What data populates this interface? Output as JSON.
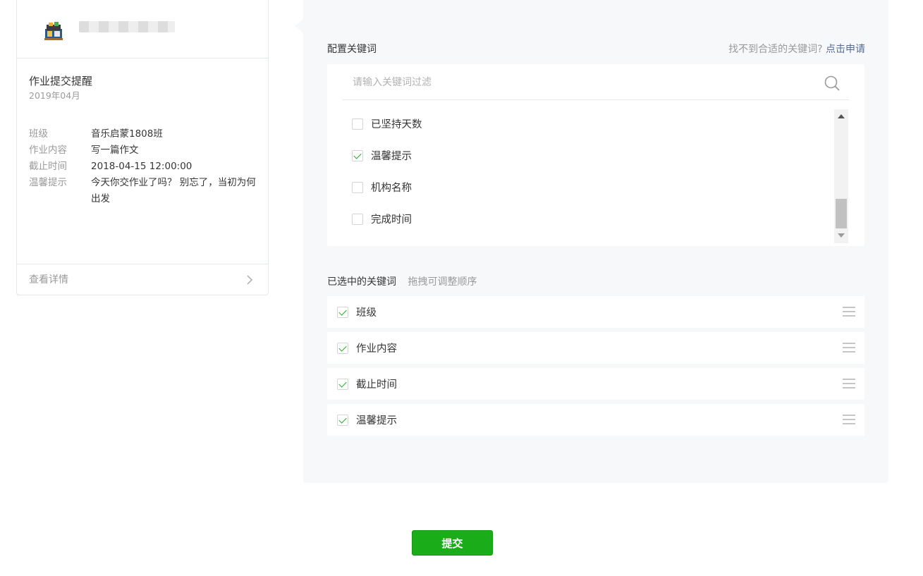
{
  "preview": {
    "message_title": "作业提交提醒",
    "message_date": "2019年04月",
    "fields": [
      {
        "key": "班级",
        "value": "音乐启蒙1808班"
      },
      {
        "key": "作业内容",
        "value": "写一篇作文"
      },
      {
        "key": "截止时间",
        "value": "2018-04-15 12:00:00"
      },
      {
        "key": "温馨提示",
        "value": "今天你交作业了吗？ 别忘了，当初为何出发"
      }
    ],
    "detail_link": "查看详情"
  },
  "config": {
    "title": "配置关键词",
    "tip_text": "找不到合适的关键词?",
    "tip_link": "点击申请",
    "search_placeholder": "请输入关键词过滤",
    "keywords": [
      {
        "label": "已坚持天数",
        "checked": false
      },
      {
        "label": "温馨提示",
        "checked": true
      },
      {
        "label": "机构名称",
        "checked": false
      },
      {
        "label": "完成时间",
        "checked": false
      }
    ],
    "selected_title": "已选中的关键词",
    "selected_hint": "拖拽可调整顺序",
    "selected": [
      {
        "label": "班级"
      },
      {
        "label": "作业内容"
      },
      {
        "label": "截止时间"
      },
      {
        "label": "温馨提示"
      }
    ]
  },
  "submit_label": "提交",
  "colors": {
    "accent": "#1aad19",
    "link": "#576b95",
    "panel_bg": "#f6f8f9"
  }
}
